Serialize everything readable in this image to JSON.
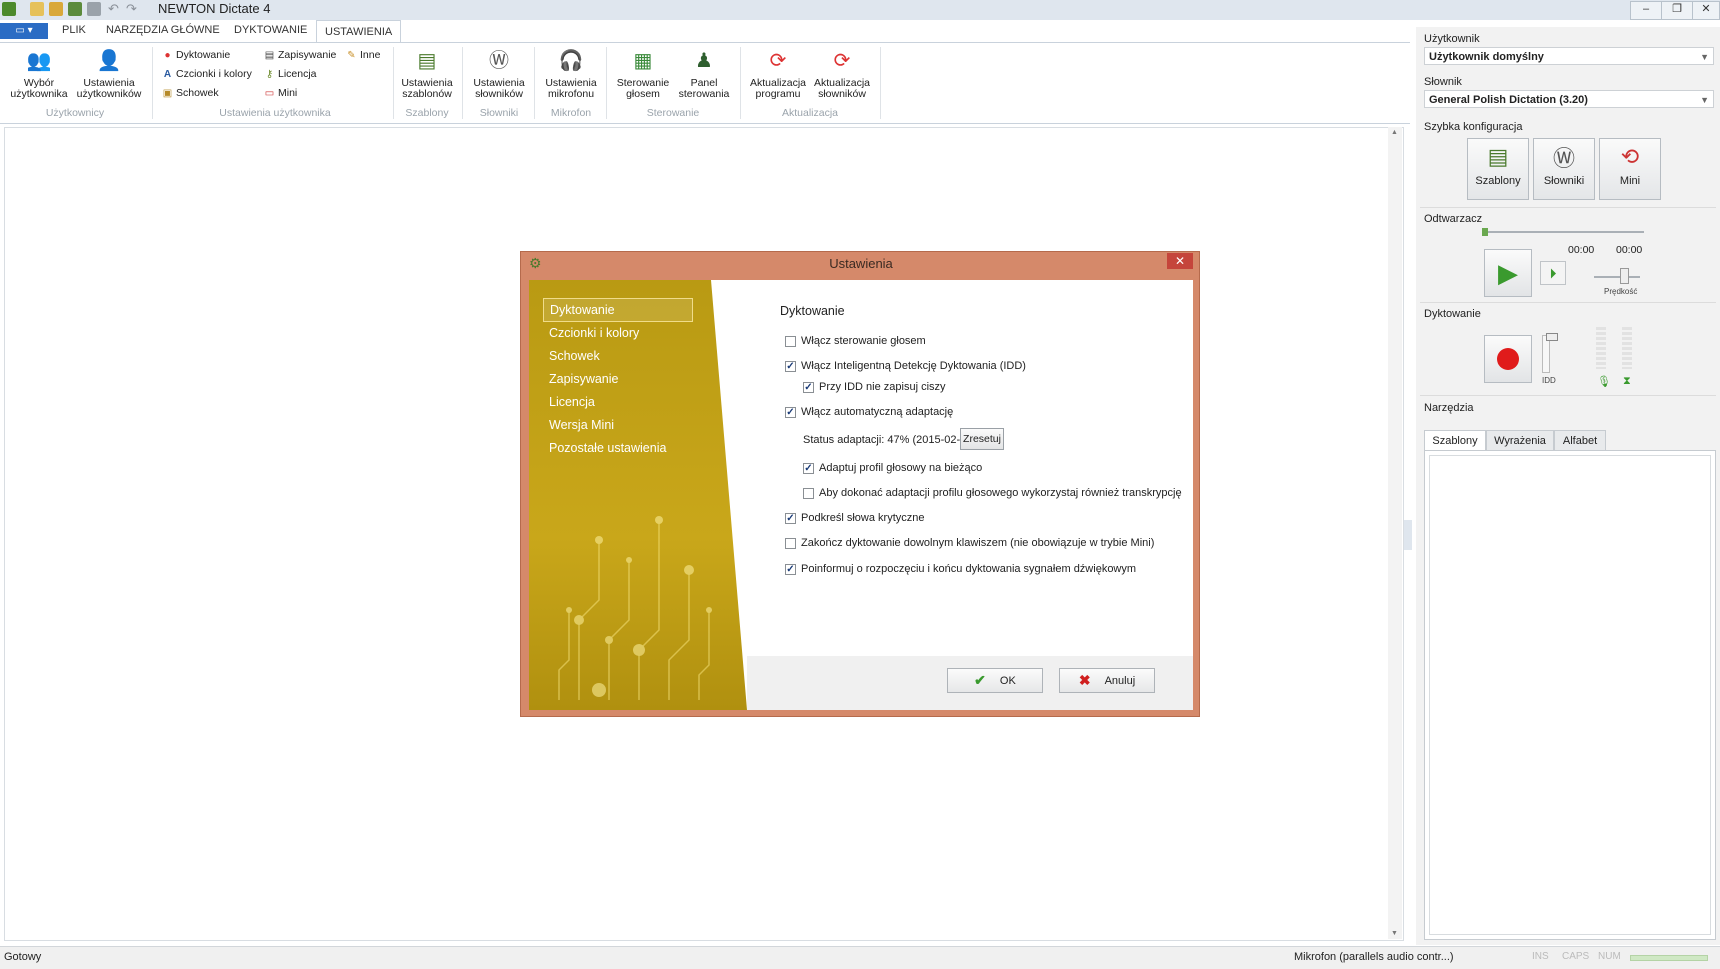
{
  "app": {
    "title": "NEWTON Dictate 4"
  },
  "ribbon_tabs": [
    "PLIK",
    "NARZĘDZIA GŁÓWNE",
    "DYKTOWANIE",
    "USTAWIENIA"
  ],
  "ribbon": {
    "wybor": "Wybór użytkownika",
    "ust_uzytk": "Ustawienia użytkowników",
    "group_uzytkownicy": "Użytkownicy",
    "dyktowanie": "Dyktowanie",
    "czcionki": "Czcionki i kolory",
    "schowek": "Schowek",
    "zapisywanie": "Zapisywanie",
    "licencja": "Licencja",
    "mini": "Mini",
    "inne": "Inne",
    "group_ust_uzytk": "Ustawienia użytkownika",
    "ust_szablonow": "Ustawienia szablonów",
    "group_szablony": "Szablony",
    "ust_slownikow": "Ustawienia słowników",
    "group_slowniki": "Słowniki",
    "ust_mikrofonu": "Ustawienia mikrofonu",
    "group_mikrofon": "Mikrofon",
    "sterowanie_glosem": "Sterowanie głosem",
    "panel_sterowania": "Panel sterowania",
    "group_sterowanie": "Sterowanie",
    "akt_programu": "Aktualizacja programu",
    "akt_slownikow": "Aktualizacja słowników",
    "group_aktualizacja": "Aktualizacja"
  },
  "right_panel": {
    "uzytkownik_label": "Użytkownik",
    "uzytkownik_value": "Użytkownik domyślny",
    "slownik_label": "Słownik",
    "slownik_value": "General Polish Dictation (3.20)",
    "szybka_label": "Szybka konfiguracja",
    "qc_szablony": "Szablony",
    "qc_slowniki": "Słowniki",
    "qc_mini": "Mini",
    "odtwarzacz_label": "Odtwarzacz",
    "time1": "00:00",
    "time2": "00:00",
    "predkosc": "Prędkość",
    "dyktowanie_label": "Dyktowanie",
    "idd": "IDD",
    "narzedzia_label": "Narzędzia",
    "tabs": [
      "Szablony",
      "Wyrażenia",
      "Alfabet"
    ]
  },
  "status": {
    "left": "Gotowy",
    "mic": "Mikrofon (parallels audio contr...)",
    "ins": "INS",
    "caps": "CAPS",
    "num": "NUM"
  },
  "dialog": {
    "title": "Ustawienia",
    "nav": [
      "Dyktowanie",
      "Czcionki i kolory",
      "Schowek",
      "Zapisywanie",
      "Licencja",
      "Wersja Mini",
      "Pozostałe ustawienia"
    ],
    "section_title": "Dyktowanie",
    "options": {
      "opt1": "Włącz sterowanie głosem",
      "opt2": "Włącz Inteligentną Detekcję Dyktowania (IDD)",
      "opt3": "Przy IDD nie zapisuj ciszy",
      "opt4": "Włącz automatyczną adaptację",
      "status": "Status adaptacji: 47% (2015-02-27)",
      "reset": "Zresetuj",
      "opt5": "Adaptuj profil głosowy na bieżąco",
      "opt6": "Aby dokonać adaptacji profilu głosowego wykorzystaj również transkrypcję",
      "opt7": "Podkreśl słowa krytyczne",
      "opt8": "Zakończ dyktowanie dowolnym klawiszem (nie obowiązuje w trybie Mini)",
      "opt9": "Poinformuj o rozpoczęciu i końcu dyktowania sygnałem dźwiękowym"
    },
    "checked": {
      "opt1": false,
      "opt2": true,
      "opt3": true,
      "opt4": true,
      "opt5": true,
      "opt6": false,
      "opt7": true,
      "opt8": false,
      "opt9": true
    },
    "ok": "OK",
    "cancel": "Anuluj"
  },
  "colors": {
    "dialog_frame": "#d5896a",
    "nav_gold": "#c9a71a",
    "close_red": "#c5453b",
    "record_red": "#e01b1b",
    "play_green": "#3a9a2e"
  }
}
